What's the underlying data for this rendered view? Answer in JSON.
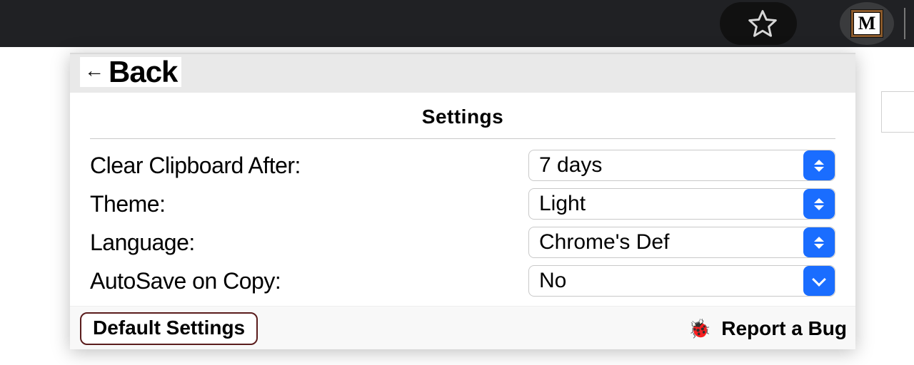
{
  "toolbar": {
    "star_name": "star-icon",
    "extension_glyph": "M"
  },
  "popup": {
    "back_arrow": "←",
    "back_label": "Back",
    "title": "Settings",
    "rows": [
      {
        "label": "Clear Clipboard After:",
        "value": "7 days"
      },
      {
        "label": "Theme:",
        "value": "Light"
      },
      {
        "label": "Language:",
        "value": "Chrome's Def"
      },
      {
        "label": "AutoSave on Copy:",
        "value": "No"
      }
    ],
    "default_button": "Default Settings",
    "report_icon": "🐞",
    "report_label": "Report a Bug"
  }
}
